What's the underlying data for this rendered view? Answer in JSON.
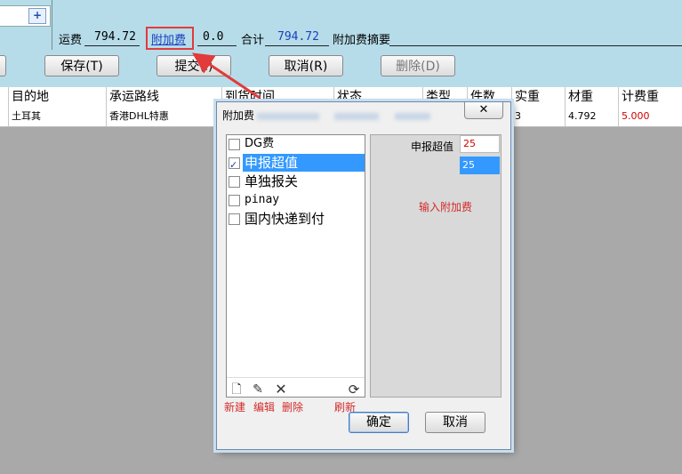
{
  "header": {
    "freight_label": "运费",
    "freight_value": "794.72",
    "surcharge_link": "附加费",
    "surcharge_value": "0.0",
    "total_label": "合计",
    "total_value": "794.72",
    "surcharge_summary_label": "附加费摘要",
    "expand_symbol": "+"
  },
  "toolbar": {
    "save": "保存(T)",
    "submit": "提交(I)",
    "cancel": "取消(R)",
    "delete": "删除(D)"
  },
  "table": {
    "headers": [
      "目的地",
      "承运路线",
      "到货时间",
      "状态",
      "类型",
      "件数",
      "实重",
      "材重",
      "计费重"
    ],
    "row": {
      "destination": "土耳其",
      "route": "香港DHL特惠",
      "pieces": "3",
      "volume_weight": "4.792",
      "charge_weight": "5.000"
    }
  },
  "dialog": {
    "title": "附加费",
    "close_symbol": "✕",
    "items": [
      {
        "label": "DG费",
        "checked": false
      },
      {
        "label": "申报超值",
        "checked": true
      },
      {
        "label": "单独报关",
        "checked": false
      },
      {
        "label": "pinay",
        "checked": false
      },
      {
        "label": "国内快递到付",
        "checked": false
      }
    ],
    "icon_labels": {
      "new": "新建",
      "edit": "编辑",
      "delete": "删除",
      "refresh": "刷新"
    },
    "field_label": "申报超值",
    "field_value": "25",
    "selected_option": "25",
    "hint": "输入附加费",
    "ok": "确定",
    "cancel": "取消"
  },
  "colors": {
    "accent_red": "#d42b2b",
    "selection_blue": "#3399ff",
    "header_band": "#b6dce9"
  }
}
